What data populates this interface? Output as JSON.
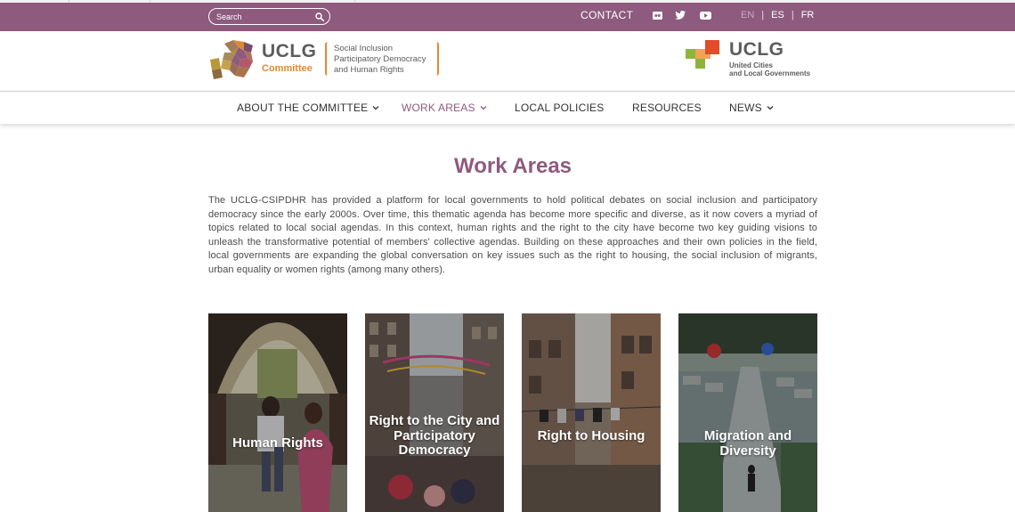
{
  "topbar": {
    "search_placeholder": "Search",
    "contact_label": "CONTACT",
    "languages": [
      "EN",
      "ES",
      "FR"
    ],
    "active_language": "EN",
    "social_icons": [
      "flickr-icon",
      "twitter-icon",
      "youtube-icon"
    ]
  },
  "header": {
    "logo_left": {
      "brand": "UCLG",
      "sub": "Committee",
      "tagline": [
        "Social Inclusion",
        "Participatory Democracy",
        "and Human Rights"
      ]
    },
    "logo_right": {
      "brand": "UCLG",
      "sub": [
        "United Cities",
        "and Local Governments"
      ]
    }
  },
  "nav": {
    "items": [
      {
        "label": "ABOUT THE COMMITTEE",
        "has_dropdown": true,
        "active": false
      },
      {
        "label": "WORK AREAS",
        "has_dropdown": true,
        "active": true
      },
      {
        "label": "LOCAL POLICIES",
        "has_dropdown": false,
        "active": false
      },
      {
        "label": "RESOURCES",
        "has_dropdown": false,
        "active": false
      },
      {
        "label": "NEWS",
        "has_dropdown": true,
        "active": false
      }
    ]
  },
  "main": {
    "title": "Work Areas",
    "intro": "The UCLG-CSIPDHR has provided a platform for local governments to hold political debates on social inclusion and participatory democracy since the early 2000s. Over time, this thematic agenda has become more specific and diverse, as it now covers a myriad of topics related to local social agendas. In this context, human rights and the right to the city have become two key guiding visions to unleash the transformative potential of members' collective agendas. Building on these approaches and their own policies in the field, local governments are expanding the global conversation on key issues such as the right to housing, the social inclusion of migrants, urban equality or women rights (among many others).",
    "cards": [
      {
        "label": "Human Rights"
      },
      {
        "label": "Right to the City and Participatory Democracy"
      },
      {
        "label": "Right to Housing"
      },
      {
        "label": "Migration and Diversity"
      }
    ]
  },
  "colors": {
    "brand_purple": "#8e5a7e",
    "accent_orange": "#e0883c",
    "logo_green": "#8db53c",
    "logo_red": "#e34b2b"
  }
}
